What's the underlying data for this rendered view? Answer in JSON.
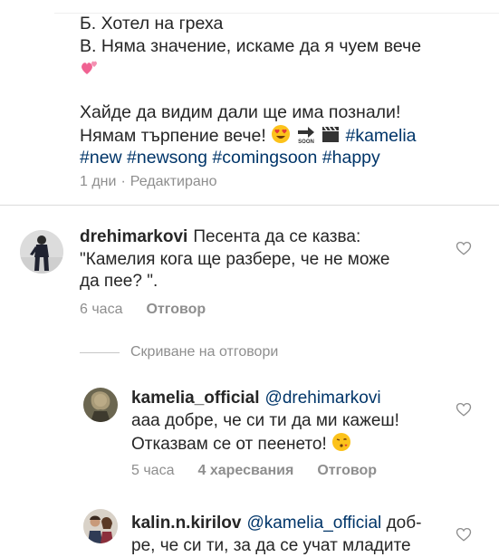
{
  "caption": {
    "line_b": "Б. Хотел на греха",
    "line_v": "В. Няма значение, искаме да я чуем вече",
    "line_wish1": "Хайде да видим дали ще има познали!",
    "line_wish2_text": "Нямам търпение вече!",
    "tags_line1": "#kamelia",
    "tags_line2": [
      "#new",
      "#newsong",
      "#comingsoon",
      "#happy"
    ],
    "time": "1 дни",
    "edited": "Редактирано",
    "separator": "·"
  },
  "comments": [
    {
      "username": "drehimarkovi",
      "text_line1": "Песента да се казва:",
      "text_line2": "\"Камелия кога ще разбере, че не може",
      "text_line3": "да пее? \".",
      "time": "6 часа",
      "reply_label": "Отговор"
    }
  ],
  "replies_toggle": {
    "label": "Скриване на отговори"
  },
  "replies": [
    {
      "username": "kamelia_official",
      "mention": "@drehimarkovi",
      "text_line2": "ааа добре, че си ти да ми кажеш!",
      "text_line3": "Отказвам се от пеенето!",
      "time": "5 часа",
      "likes": "4 харесвания",
      "reply_label": "Отговор"
    },
    {
      "username": "kalin.n.kirilov",
      "mention": "@kamelia_official",
      "text_tail": "доб-",
      "text_line2": "ре, че си ти, за да се учат младите"
    }
  ],
  "icons": {
    "heart": "heart-outline-icon",
    "emoji_heart": "two-hearts-emoji",
    "emoji_love": "heart-eyes-emoji",
    "emoji_soon": "soon-arrow-emoji",
    "emoji_clapper": "clapper-board-emoji",
    "emoji_kiss": "kissing-face-emoji"
  },
  "colors": {
    "link": "#003569",
    "meta": "#8e8e8e",
    "text": "#262626"
  }
}
